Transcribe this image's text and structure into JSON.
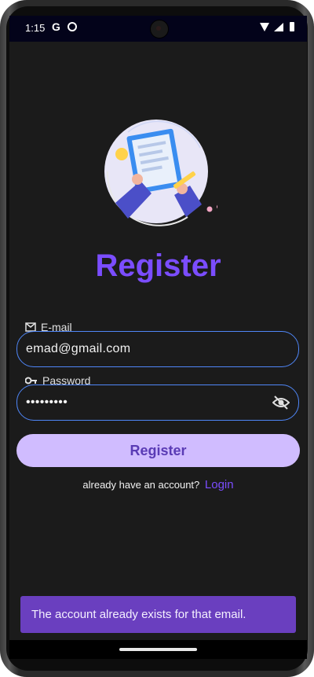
{
  "status_bar": {
    "time": "1:15",
    "g_label": "G"
  },
  "title": "Register",
  "email_field": {
    "label": "E-mail",
    "value": "emad@gmail.com"
  },
  "password_field": {
    "label": "Password",
    "value": "•••••••••"
  },
  "register_button": {
    "label": "Register"
  },
  "login_prompt": {
    "text": "already have an account?",
    "link": "Login"
  },
  "snackbar": {
    "message": "The account already exists for that email."
  },
  "colors": {
    "accent": "#7b4dff",
    "button_bg": "#d0bcff",
    "button_text": "#5a3bb5",
    "field_border": "#4f86f7",
    "snackbar_bg": "#6a3fbf",
    "screen_bg": "#1b1b1b"
  },
  "icons": [
    "google-icon",
    "app-icon",
    "wifi-icon",
    "signal-icon",
    "battery-icon",
    "mail-icon",
    "key-icon",
    "eye-off-icon"
  ]
}
